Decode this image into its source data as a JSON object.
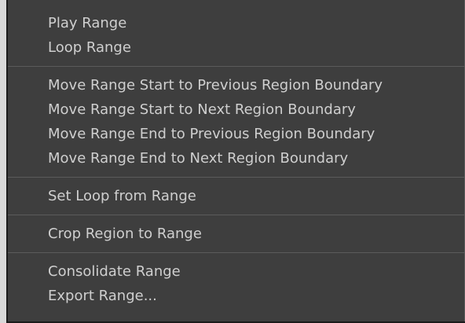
{
  "menu": {
    "groups": [
      {
        "items": [
          {
            "label": "Play Range"
          },
          {
            "label": "Loop Range"
          }
        ]
      },
      {
        "items": [
          {
            "label": "Move Range Start to Previous Region Boundary"
          },
          {
            "label": "Move Range Start to Next Region Boundary"
          },
          {
            "label": "Move Range End to Previous Region Boundary"
          },
          {
            "label": "Move Range End to Next Region Boundary"
          }
        ]
      },
      {
        "items": [
          {
            "label": "Set Loop from Range"
          }
        ]
      },
      {
        "items": [
          {
            "label": "Crop Region to Range"
          }
        ]
      },
      {
        "items": [
          {
            "label": "Consolidate Range"
          },
          {
            "label": "Export Range..."
          }
        ]
      }
    ]
  },
  "colors": {
    "menu_background": "#3e3e3e",
    "text": "#cfcfcf",
    "separator": "#5b5b5b"
  }
}
